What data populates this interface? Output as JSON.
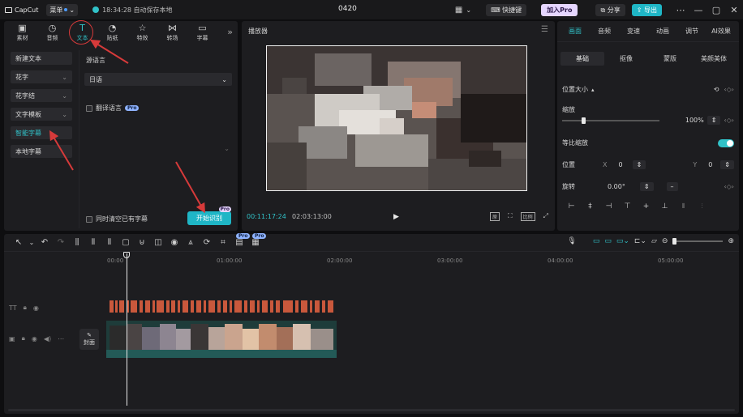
{
  "titlebar": {
    "logo": "CapCut",
    "menu": "菜单",
    "autosave": "18:34:28 自动保存本地",
    "project_title": "0420",
    "shortcut": "快捷键",
    "join_pro": "加入Pro",
    "share": "分享",
    "export": "导出"
  },
  "tools": [
    {
      "icon": "▣",
      "label": "素材"
    },
    {
      "icon": "◷",
      "label": "音频"
    },
    {
      "icon": "T",
      "label": "文本"
    },
    {
      "icon": "◔",
      "label": "贴纸"
    },
    {
      "icon": "☆",
      "label": "特效"
    },
    {
      "icon": "⋈",
      "label": "转场"
    },
    {
      "icon": "▭",
      "label": "字幕"
    }
  ],
  "sidenav": [
    {
      "label": "新建文本",
      "arrow": ""
    },
    {
      "label": "花字",
      "arrow": "⌄"
    },
    {
      "label": "花字结",
      "arrow": "⌄"
    },
    {
      "label": "文字模板",
      "arrow": "⌄"
    },
    {
      "label": "智能字幕",
      "arrow": ""
    },
    {
      "label": "本地字幕",
      "arrow": ""
    }
  ],
  "caption_panel": {
    "source_label": "源语言",
    "source_value": "日语",
    "translate_label": "翻译语言",
    "pro_badge": "Pro",
    "clear_label": "同时清空已有字幕",
    "start_button": "开始识别",
    "start_pro": "Pro"
  },
  "player": {
    "title": "播放器",
    "time_current": "00:11:17:24",
    "time_total": "02:03:13:00",
    "fit_label": "原",
    "ratio_label": "比例"
  },
  "props": {
    "tabs": [
      "画面",
      "音频",
      "变速",
      "动画",
      "调节",
      "AI效果"
    ],
    "subtabs": [
      "基础",
      "抠像",
      "蒙版",
      "美颜美体"
    ],
    "position_size": "位置大小",
    "scale": "缩放",
    "scale_value": "100%",
    "uniform_scale": "等比缩放",
    "position": "位置",
    "x_label": "X",
    "x_value": "0",
    "y_label": "Y",
    "y_value": "0",
    "rotation": "旋转",
    "rotation_value": "0.00°"
  },
  "timeline": {
    "ruler_ticks": [
      "00:00",
      "01:00:00",
      "02:00:00",
      "03:00:00",
      "04:00:00",
      "05:00:00"
    ],
    "cover_label": "封面",
    "pro_badge": "Pro"
  },
  "colors": {
    "accent": "#31c2c8",
    "annotation": "#d63a3a",
    "text_clip": "#c9583c"
  }
}
